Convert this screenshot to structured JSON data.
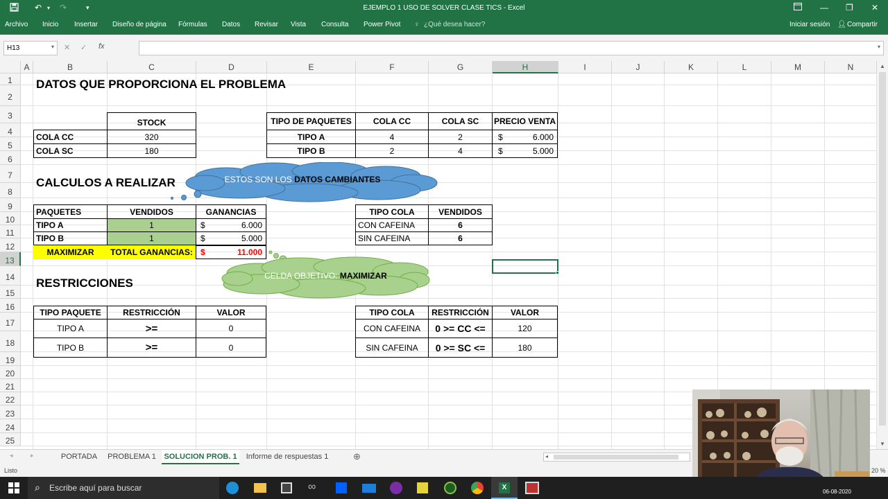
{
  "window": {
    "title": "EJEMPLO 1 USO DE SOLVER CLASE TICS - Excel",
    "signin": "Iniciar sesión",
    "share": "Compartir"
  },
  "ribbon": {
    "tabs": [
      "Archivo",
      "Inicio",
      "Insertar",
      "Diseño de página",
      "Fórmulas",
      "Datos",
      "Revisar",
      "Vista",
      "Consulta",
      "Power Pivot"
    ],
    "tell_me": "¿Qué desea hacer?"
  },
  "formula_bar": {
    "name_box": "H13",
    "fx": "fx",
    "value": ""
  },
  "columns": [
    "A",
    "B",
    "C",
    "D",
    "E",
    "F",
    "G",
    "H",
    "I",
    "J",
    "K",
    "L",
    "M",
    "N"
  ],
  "rows": [
    "1",
    "2",
    "3",
    "4",
    "5",
    "6",
    "7",
    "8",
    "9",
    "10",
    "11",
    "12",
    "13",
    "14",
    "15",
    "16",
    "17",
    "18",
    "19",
    "20",
    "21",
    "22",
    "23",
    "24",
    "25"
  ],
  "sheet": {
    "title1": "DATOS QUE PROPORCIONA EL PROBLEMA",
    "stock": {
      "header": "STOCK",
      "rows": [
        {
          "label": "COLA CC",
          "value": "320"
        },
        {
          "label": "COLA SC",
          "value": "180"
        }
      ]
    },
    "paquetes": {
      "headers": [
        "TIPO DE PAQUETES",
        "COLA CC",
        "COLA SC",
        "PRECIO VENTA"
      ],
      "rows": [
        {
          "tipo": "TIPO A",
          "cc": "4",
          "sc": "2",
          "cur": "$",
          "price": "6.000"
        },
        {
          "tipo": "TIPO B",
          "cc": "2",
          "sc": "4",
          "cur": "$",
          "price": "5.000"
        }
      ]
    },
    "title2": "CALCULOS A REALIZAR",
    "cloud1": {
      "text1": "ESTOS SON LOS ",
      "text2": "DATOS CAMBIANTES"
    },
    "calc": {
      "headers": [
        "PAQUETES",
        "VENDIDOS",
        "GANANCIAS"
      ],
      "rows": [
        {
          "label": "TIPO A",
          "vendidos": "1",
          "cur": "$",
          "gan": "6.000"
        },
        {
          "label": "TIPO B",
          "vendidos": "1",
          "cur": "$",
          "gan": "5.000"
        }
      ],
      "max_label": "MAXIMIZAR",
      "total_label": "TOTAL GANANCIAS:",
      "total_cur": "$",
      "total_value": "11.000"
    },
    "cola": {
      "headers": [
        "TIPO COLA",
        "VENDIDOS"
      ],
      "rows": [
        {
          "label": "CON CAFEINA",
          "value": "6"
        },
        {
          "label": "SIN CAFEINA",
          "value": "6"
        }
      ]
    },
    "cloud2": {
      "text1": "CELDA OBJETIVO: ",
      "text2": "MAXIMIZAR"
    },
    "title3": "RESTRICCIONES",
    "restr1": {
      "headers": [
        "TIPO PAQUETE",
        "RESTRICCIÓN",
        "VALOR"
      ],
      "rows": [
        {
          "tipo": "TIPO A",
          "r": ">=",
          "v": "0"
        },
        {
          "tipo": "TIPO B",
          "r": ">=",
          "v": "0"
        }
      ]
    },
    "restr2": {
      "headers": [
        "TIPO COLA",
        "RESTRICCIÓN",
        "VALOR"
      ],
      "rows": [
        {
          "tipo": "CON CAFEINA",
          "r": "0 >= CC <=",
          "v": "120"
        },
        {
          "tipo": "SIN CAFEINA",
          "r": "0 >= SC <=",
          "v": "180"
        }
      ]
    }
  },
  "sheet_tabs": [
    "PORTADA",
    "PROBLEMA 1",
    "SOLUCION PROB. 1",
    "Informe de respuestas 1"
  ],
  "status": {
    "ready": "Listo",
    "zoom": "20 %"
  },
  "taskbar": {
    "search": "Escribe aquí para buscar",
    "date": "06-08-2020"
  },
  "colors": {
    "excel_green": "#217346",
    "cell_green": "#a9d08e",
    "yellow": "#ffff00",
    "cloud_blue": "#5b9bd5",
    "cloud_green": "#a9d18e"
  }
}
